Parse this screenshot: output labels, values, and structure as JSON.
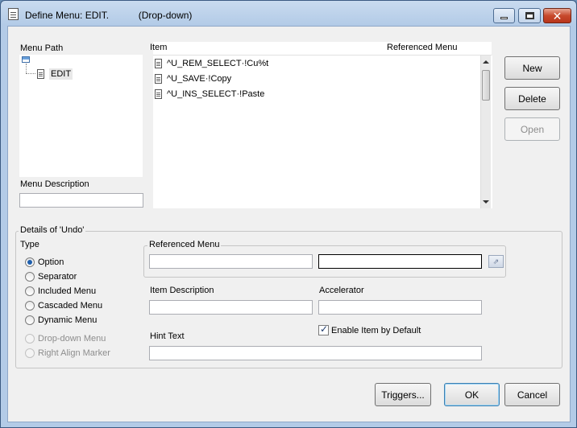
{
  "window": {
    "title": "Define Menu: EDIT.           (Drop-down)",
    "controls": {
      "minimize": "minimize",
      "maximize": "maximize",
      "close": "✕"
    }
  },
  "menu_path": {
    "header": "Menu Path",
    "node": "EDIT"
  },
  "menu_description": {
    "label": "Menu Description",
    "value": ""
  },
  "items_list": {
    "column_item": "Item",
    "column_referenced_menu": "Referenced Menu",
    "rows": [
      {
        "item": "^U_REM_SELECT·!Cu%t",
        "referenced_menu": ""
      },
      {
        "item": "^U_SAVE·!Copy",
        "referenced_menu": ""
      },
      {
        "item": "^U_INS_SELECT·!Paste",
        "referenced_menu": ""
      }
    ]
  },
  "side_buttons": {
    "new": "New",
    "delete": "Delete",
    "open": "Open"
  },
  "details": {
    "title": "Details of 'Undo'",
    "type_label": "Type",
    "types": [
      {
        "label": "Option",
        "checked": true,
        "enabled": true
      },
      {
        "label": "Separator",
        "checked": false,
        "enabled": true
      },
      {
        "label": "Included Menu",
        "checked": false,
        "enabled": true
      },
      {
        "label": "Cascaded Menu",
        "checked": false,
        "enabled": true
      },
      {
        "label": "Dynamic Menu",
        "checked": false,
        "enabled": true
      },
      {
        "label": "Drop-down Menu",
        "checked": false,
        "enabled": false
      },
      {
        "label": "Right Align Marker",
        "checked": false,
        "enabled": false
      }
    ],
    "referenced_menu": {
      "group_label": "Referenced Menu",
      "field1": "",
      "field2": ""
    },
    "item_description": {
      "label": "Item Description",
      "value": ""
    },
    "accelerator": {
      "label": "Accelerator",
      "value": ""
    },
    "enable_by_default": {
      "label": "Enable Item by Default",
      "checked": true
    },
    "hint_text": {
      "label": "Hint Text",
      "value": ""
    }
  },
  "footer_buttons": {
    "triggers": "Triggers...",
    "ok": "OK",
    "cancel": "Cancel"
  },
  "colors": {
    "title_bar": "#b3cbe7",
    "close_button": "#c7492c",
    "dialog_bg": "#f0f0f0",
    "radio_selected": "#1e5fad"
  }
}
